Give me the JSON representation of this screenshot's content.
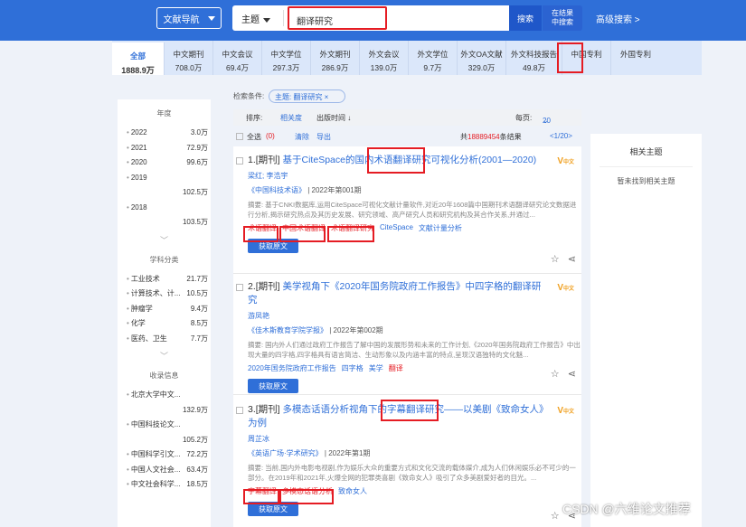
{
  "header": {
    "nav_label": "文献导航",
    "field_label": "主题",
    "query": "翻译研究",
    "search_label": "搜索",
    "in_result_line1": "在结果",
    "in_result_line2": "中搜索",
    "advanced": "高级搜索 >"
  },
  "tabs": [
    {
      "label": "全部",
      "count": "1888.9万"
    },
    {
      "label": "中文期刊",
      "count": "708.0万"
    },
    {
      "label": "中文会议",
      "count": "69.4万"
    },
    {
      "label": "中文学位",
      "count": "297.3万"
    },
    {
      "label": "外文期刊",
      "count": "286.9万"
    },
    {
      "label": "外文会议",
      "count": "139.0万"
    },
    {
      "label": "外文学位",
      "count": "9.7万"
    },
    {
      "label": "外文OA文献",
      "count": "329.0万"
    },
    {
      "label": "外文科技报告",
      "count": "49.8万"
    },
    {
      "label": "中国专利",
      "count": ""
    },
    {
      "label": "外国专利",
      "count": ""
    }
  ],
  "sidebar": {
    "year_title": "年度",
    "years": [
      {
        "label": "2022",
        "value": "3.0万"
      },
      {
        "label": "2021",
        "value": "72.9万"
      },
      {
        "label": "2020",
        "value": "99.6万"
      },
      {
        "label": "2019",
        "value": ""
      },
      {
        "label": "",
        "value": "102.5万"
      },
      {
        "label": "2018",
        "value": ""
      },
      {
        "label": "",
        "value": "103.5万"
      }
    ],
    "subject_title": "学科分类",
    "subjects": [
      {
        "label": "工业技术",
        "value": "21.7万"
      },
      {
        "label": "计算技术、计...",
        "value": "10.5万"
      },
      {
        "label": "肿瘤学",
        "value": "9.4万"
      },
      {
        "label": "化学",
        "value": "8.5万"
      },
      {
        "label": "医药、卫生",
        "value": "7.7万"
      }
    ],
    "collection_title": "收录信息",
    "collections": [
      {
        "label": "北京大学中文...",
        "value": ""
      },
      {
        "label": "",
        "value": "132.9万"
      },
      {
        "label": "中国科技论文...",
        "value": ""
      },
      {
        "label": "",
        "value": "105.2万"
      },
      {
        "label": "中国科学引文...",
        "value": "72.2万"
      },
      {
        "label": "中国人文社会...",
        "value": "63.4万"
      },
      {
        "label": "中文社会科学...",
        "value": "18.5万"
      }
    ]
  },
  "filters": {
    "condition_label": "检索条件:",
    "chip": "主题: 翻译研究 ×",
    "sort_label": "排序:",
    "sort_relevance": "相关度",
    "sort_time": "出版时间 ↓",
    "per_page_label": "每页:",
    "per_page": "20",
    "select_all": "全选",
    "selected_count": "(0)",
    "clear": "清除",
    "export": "导出",
    "total_prefix": "共",
    "total": "18889454",
    "total_suffix": "条结果",
    "pager": "<1/20>"
  },
  "results": [
    {
      "index": "1.[期刊]",
      "title": "基于CiteSpace的国内术语翻译研究可视化分析(2001—2020)",
      "authors": "梁红; 李浩宇",
      "journal": "《中国科技术语》",
      "issue": "| 2022年第001期",
      "abstract": "摘要: 基于CNKI数据库,运用CiteSpace可视化文献计量软件,对近20年1608篇中国期刊术语翻译研究论文数据进行分析,揭示研究热点及其历史发展、研究领域、高产研究人员和研究机构及其合作关系,并通过...",
      "keywords": [
        "术语翻译",
        "中国术语翻译",
        "术语翻译研究",
        "CiteSpace",
        "文献计量分析"
      ],
      "get_label": "获取原文",
      "badge": "V",
      "badge_sub": "中文"
    },
    {
      "index": "2.[期刊]",
      "title": "美学视角下《2020年国务院政府工作报告》中四字格的翻译研究",
      "authors": "游凤艳",
      "journal": "《佳木斯教育学院学报》",
      "issue": "| 2022年第002期",
      "abstract": "摘要: 国内外人们通过政府工作报告了解中国的发展形势和未来的工作计划,《2020年国务院政府工作报告》中出现大量的四字格,四字格具有语言简洁、生动形象以及内涵丰富的特点,呈现汉语独特的文化魅...",
      "keywords": [
        "2020年国务院政府工作报告",
        "四字格",
        "美学",
        "翻译"
      ],
      "get_label": "获取原文",
      "badge": "V",
      "badge_sub": "中文"
    },
    {
      "index": "3.[期刊]",
      "title": "多模态话语分析视角下的字幕翻译研究——以美剧《致命女人》为例",
      "authors": "周芷冰",
      "journal": "《英语广场·学术研究》",
      "issue": "| 2022年第1期",
      "abstract": "摘要: 当前,国内外电影电视剧,作为娱乐大众的重要方式和文化交流的载体媒介,成为人们休闲娱乐必不可少的一部分。在2019年和2021年,火爆全网的犯罪类喜剧《致命女人》吸引了众多美剧爱好者的目光。...",
      "keywords": [
        "字幕翻译",
        "多模态话语分析",
        "致命女人"
      ],
      "get_label": "获取原文",
      "badge": "V",
      "badge_sub": "中文"
    }
  ],
  "right_panel": {
    "title": "相关主题",
    "empty": "暂未找到相关主题"
  },
  "watermark": "CSDN @六维论文推荐",
  "colors": {
    "primary": "#2f6fd8",
    "highlight": "#e51c23"
  }
}
